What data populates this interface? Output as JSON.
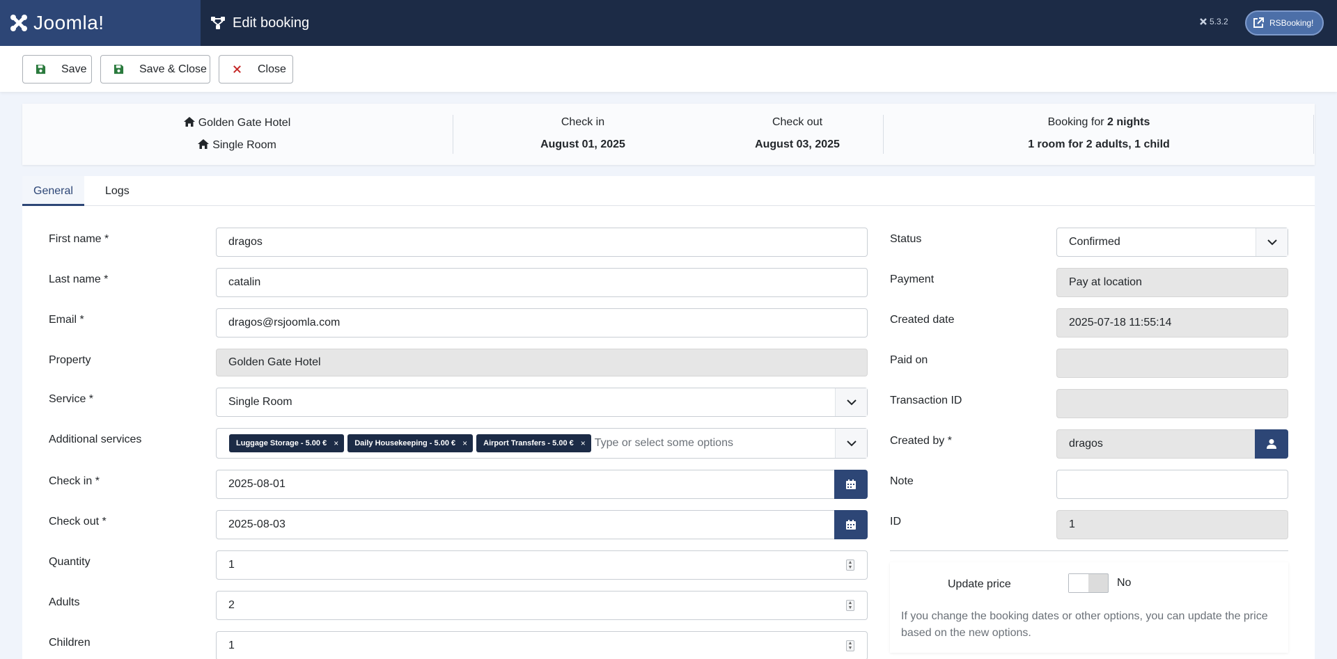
{
  "header": {
    "brand": "Joomla!",
    "title": "Edit booking",
    "version": "5.3.2",
    "site_button": "RSBooking!"
  },
  "toolbar": {
    "save": "Save",
    "save_close": "Save & Close",
    "close": "Close"
  },
  "summary": {
    "hotel": "Golden Gate Hotel",
    "room": "Single Room",
    "checkin_label": "Check in",
    "checkin_value": "August 01, 2025",
    "checkout_label": "Check out",
    "checkout_value": "August 03, 2025",
    "booking_for_prefix": "Booking for",
    "nights": "2 nights",
    "occupancy": "1 room for 2 adults, 1 child"
  },
  "tabs": [
    "General",
    "Logs"
  ],
  "left_fields": {
    "first_name": {
      "label": "First name *",
      "value": "dragos"
    },
    "last_name": {
      "label": "Last name *",
      "value": "catalin"
    },
    "email": {
      "label": "Email *",
      "value": "dragos@rsjoomla.com"
    },
    "property": {
      "label": "Property",
      "value": "Golden Gate Hotel"
    },
    "service": {
      "label": "Service *",
      "value": "Single Room"
    },
    "additional": {
      "label": "Additional services",
      "chips": [
        "Luggage Storage - 5.00 €",
        "Daily Housekeeping - 5.00 €",
        "Airport Transfers - 5.00 €"
      ],
      "placeholder": "Type or select some options"
    },
    "check_in": {
      "label": "Check in *",
      "value": "2025-08-01"
    },
    "check_out": {
      "label": "Check out *",
      "value": "2025-08-03"
    },
    "quantity": {
      "label": "Quantity",
      "value": "1"
    },
    "adults": {
      "label": "Adults",
      "value": "2"
    },
    "children": {
      "label": "Children",
      "value": "1"
    }
  },
  "right_fields": {
    "status": {
      "label": "Status",
      "value": "Confirmed"
    },
    "payment": {
      "label": "Payment",
      "value": "Pay at location"
    },
    "created_date": {
      "label": "Created date",
      "value": "2025-07-18 11:55:14"
    },
    "paid_on": {
      "label": "Paid on",
      "value": ""
    },
    "transaction_id": {
      "label": "Transaction ID",
      "value": ""
    },
    "created_by": {
      "label": "Created by *",
      "value": "dragos"
    },
    "note": {
      "label": "Note",
      "value": ""
    },
    "id": {
      "label": "ID",
      "value": "1"
    }
  },
  "update_price": {
    "label": "Update price",
    "state": "No",
    "help": "If you change the booking dates or other options, you can update the price based on the new options."
  },
  "colors": {
    "header_bg": "#1c2b46",
    "brand_bg": "#2d4676",
    "accent": "#2d4676",
    "close_icon": "#c52827"
  }
}
